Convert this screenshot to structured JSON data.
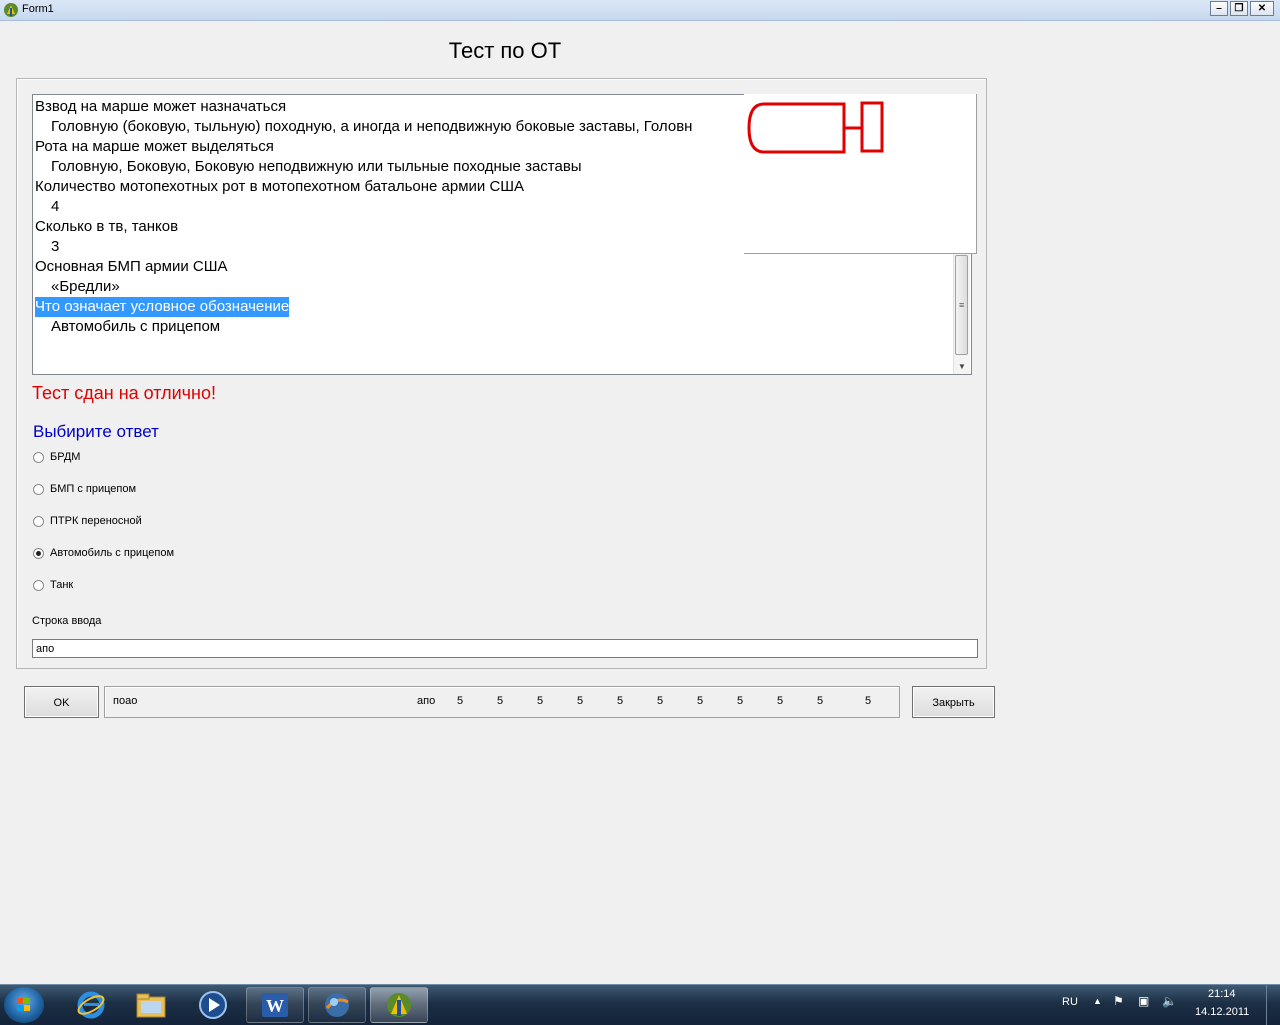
{
  "window": {
    "title": "Form1",
    "minimize_glyph": "–",
    "maximize_glyph": "❐",
    "close_glyph": "✕"
  },
  "form": {
    "heading": "Тест по ОТ",
    "memo_lines": [
      {
        "text": "Взвод на марше может назначаться",
        "type": "question"
      },
      {
        "text": "Головную (боковую, тыльную) походную, а иногда и неподвижную боковые заставы, Головн",
        "type": "answer"
      },
      {
        "text": "Рота на марше может выделяться",
        "type": "question"
      },
      {
        "text": "Головную, Боковую, Боковую неподвижную или тыльные походные заставы",
        "type": "answer"
      },
      {
        "text": "Количество мотопехотных рот в мотопехотном батальоне армии США",
        "type": "question"
      },
      {
        "text": "4",
        "type": "answer"
      },
      {
        "text": "Сколько в тв, танков",
        "type": "question"
      },
      {
        "text": "3",
        "type": "answer"
      },
      {
        "text": "Основная БМП армии США",
        "type": "question"
      },
      {
        "text": "«Бредли»",
        "type": "answer"
      },
      {
        "text": "Что означает условное обозначение",
        "type": "question",
        "selected": true
      },
      {
        "text": "Автомобиль с прицепом",
        "type": "answer"
      }
    ],
    "result_text": "Тест сдан на отлично!",
    "choose_label": "Выбирите ответ",
    "options": [
      {
        "label": "БРДМ",
        "checked": false
      },
      {
        "label": "БМП с прицепом",
        "checked": false
      },
      {
        "label": "ПТРК переносной",
        "checked": false
      },
      {
        "label": "Автомобиль с прицепом",
        "checked": true
      },
      {
        "label": "Танк",
        "checked": false
      }
    ],
    "input_label": "Строка ввода",
    "input_value": "апо",
    "ok_label": "OK",
    "close_label": "Закрыть",
    "status": {
      "left_text": "поао",
      "mid_text": "апо",
      "scores": [
        "5",
        "5",
        "5",
        "5",
        "5",
        "5",
        "5",
        "5",
        "5",
        "5",
        "5"
      ]
    }
  },
  "taskbar": {
    "language": "RU",
    "time": "21:14",
    "date": "14.12.2011"
  },
  "colors": {
    "result": "#e00000",
    "choose": "#0000c8",
    "selection": "#3399ff",
    "symbol": "#e00000"
  }
}
